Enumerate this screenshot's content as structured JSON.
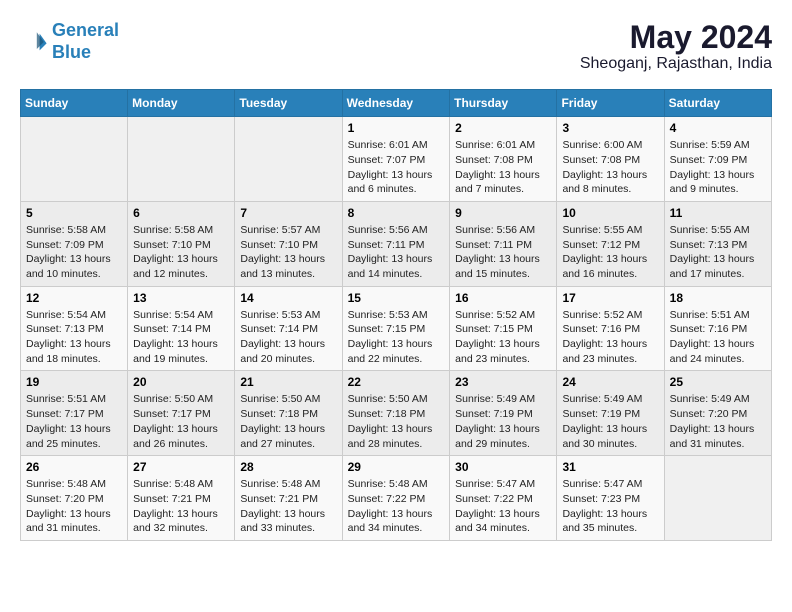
{
  "header": {
    "logo_line1": "General",
    "logo_line2": "Blue",
    "month_year": "May 2024",
    "location": "Sheoganj, Rajasthan, India"
  },
  "weekdays": [
    "Sunday",
    "Monday",
    "Tuesday",
    "Wednesday",
    "Thursday",
    "Friday",
    "Saturday"
  ],
  "weeks": [
    [
      {
        "day": "",
        "sunrise": "",
        "sunset": "",
        "daylight": ""
      },
      {
        "day": "",
        "sunrise": "",
        "sunset": "",
        "daylight": ""
      },
      {
        "day": "",
        "sunrise": "",
        "sunset": "",
        "daylight": ""
      },
      {
        "day": "1",
        "sunrise": "Sunrise: 6:01 AM",
        "sunset": "Sunset: 7:07 PM",
        "daylight": "Daylight: 13 hours and 6 minutes."
      },
      {
        "day": "2",
        "sunrise": "Sunrise: 6:01 AM",
        "sunset": "Sunset: 7:08 PM",
        "daylight": "Daylight: 13 hours and 7 minutes."
      },
      {
        "day": "3",
        "sunrise": "Sunrise: 6:00 AM",
        "sunset": "Sunset: 7:08 PM",
        "daylight": "Daylight: 13 hours and 8 minutes."
      },
      {
        "day": "4",
        "sunrise": "Sunrise: 5:59 AM",
        "sunset": "Sunset: 7:09 PM",
        "daylight": "Daylight: 13 hours and 9 minutes."
      }
    ],
    [
      {
        "day": "5",
        "sunrise": "Sunrise: 5:58 AM",
        "sunset": "Sunset: 7:09 PM",
        "daylight": "Daylight: 13 hours and 10 minutes."
      },
      {
        "day": "6",
        "sunrise": "Sunrise: 5:58 AM",
        "sunset": "Sunset: 7:10 PM",
        "daylight": "Daylight: 13 hours and 12 minutes."
      },
      {
        "day": "7",
        "sunrise": "Sunrise: 5:57 AM",
        "sunset": "Sunset: 7:10 PM",
        "daylight": "Daylight: 13 hours and 13 minutes."
      },
      {
        "day": "8",
        "sunrise": "Sunrise: 5:56 AM",
        "sunset": "Sunset: 7:11 PM",
        "daylight": "Daylight: 13 hours and 14 minutes."
      },
      {
        "day": "9",
        "sunrise": "Sunrise: 5:56 AM",
        "sunset": "Sunset: 7:11 PM",
        "daylight": "Daylight: 13 hours and 15 minutes."
      },
      {
        "day": "10",
        "sunrise": "Sunrise: 5:55 AM",
        "sunset": "Sunset: 7:12 PM",
        "daylight": "Daylight: 13 hours and 16 minutes."
      },
      {
        "day": "11",
        "sunrise": "Sunrise: 5:55 AM",
        "sunset": "Sunset: 7:13 PM",
        "daylight": "Daylight: 13 hours and 17 minutes."
      }
    ],
    [
      {
        "day": "12",
        "sunrise": "Sunrise: 5:54 AM",
        "sunset": "Sunset: 7:13 PM",
        "daylight": "Daylight: 13 hours and 18 minutes."
      },
      {
        "day": "13",
        "sunrise": "Sunrise: 5:54 AM",
        "sunset": "Sunset: 7:14 PM",
        "daylight": "Daylight: 13 hours and 19 minutes."
      },
      {
        "day": "14",
        "sunrise": "Sunrise: 5:53 AM",
        "sunset": "Sunset: 7:14 PM",
        "daylight": "Daylight: 13 hours and 20 minutes."
      },
      {
        "day": "15",
        "sunrise": "Sunrise: 5:53 AM",
        "sunset": "Sunset: 7:15 PM",
        "daylight": "Daylight: 13 hours and 22 minutes."
      },
      {
        "day": "16",
        "sunrise": "Sunrise: 5:52 AM",
        "sunset": "Sunset: 7:15 PM",
        "daylight": "Daylight: 13 hours and 23 minutes."
      },
      {
        "day": "17",
        "sunrise": "Sunrise: 5:52 AM",
        "sunset": "Sunset: 7:16 PM",
        "daylight": "Daylight: 13 hours and 23 minutes."
      },
      {
        "day": "18",
        "sunrise": "Sunrise: 5:51 AM",
        "sunset": "Sunset: 7:16 PM",
        "daylight": "Daylight: 13 hours and 24 minutes."
      }
    ],
    [
      {
        "day": "19",
        "sunrise": "Sunrise: 5:51 AM",
        "sunset": "Sunset: 7:17 PM",
        "daylight": "Daylight: 13 hours and 25 minutes."
      },
      {
        "day": "20",
        "sunrise": "Sunrise: 5:50 AM",
        "sunset": "Sunset: 7:17 PM",
        "daylight": "Daylight: 13 hours and 26 minutes."
      },
      {
        "day": "21",
        "sunrise": "Sunrise: 5:50 AM",
        "sunset": "Sunset: 7:18 PM",
        "daylight": "Daylight: 13 hours and 27 minutes."
      },
      {
        "day": "22",
        "sunrise": "Sunrise: 5:50 AM",
        "sunset": "Sunset: 7:18 PM",
        "daylight": "Daylight: 13 hours and 28 minutes."
      },
      {
        "day": "23",
        "sunrise": "Sunrise: 5:49 AM",
        "sunset": "Sunset: 7:19 PM",
        "daylight": "Daylight: 13 hours and 29 minutes."
      },
      {
        "day": "24",
        "sunrise": "Sunrise: 5:49 AM",
        "sunset": "Sunset: 7:19 PM",
        "daylight": "Daylight: 13 hours and 30 minutes."
      },
      {
        "day": "25",
        "sunrise": "Sunrise: 5:49 AM",
        "sunset": "Sunset: 7:20 PM",
        "daylight": "Daylight: 13 hours and 31 minutes."
      }
    ],
    [
      {
        "day": "26",
        "sunrise": "Sunrise: 5:48 AM",
        "sunset": "Sunset: 7:20 PM",
        "daylight": "Daylight: 13 hours and 31 minutes."
      },
      {
        "day": "27",
        "sunrise": "Sunrise: 5:48 AM",
        "sunset": "Sunset: 7:21 PM",
        "daylight": "Daylight: 13 hours and 32 minutes."
      },
      {
        "day": "28",
        "sunrise": "Sunrise: 5:48 AM",
        "sunset": "Sunset: 7:21 PM",
        "daylight": "Daylight: 13 hours and 33 minutes."
      },
      {
        "day": "29",
        "sunrise": "Sunrise: 5:48 AM",
        "sunset": "Sunset: 7:22 PM",
        "daylight": "Daylight: 13 hours and 34 minutes."
      },
      {
        "day": "30",
        "sunrise": "Sunrise: 5:47 AM",
        "sunset": "Sunset: 7:22 PM",
        "daylight": "Daylight: 13 hours and 34 minutes."
      },
      {
        "day": "31",
        "sunrise": "Sunrise: 5:47 AM",
        "sunset": "Sunset: 7:23 PM",
        "daylight": "Daylight: 13 hours and 35 minutes."
      },
      {
        "day": "",
        "sunrise": "",
        "sunset": "",
        "daylight": ""
      }
    ]
  ]
}
